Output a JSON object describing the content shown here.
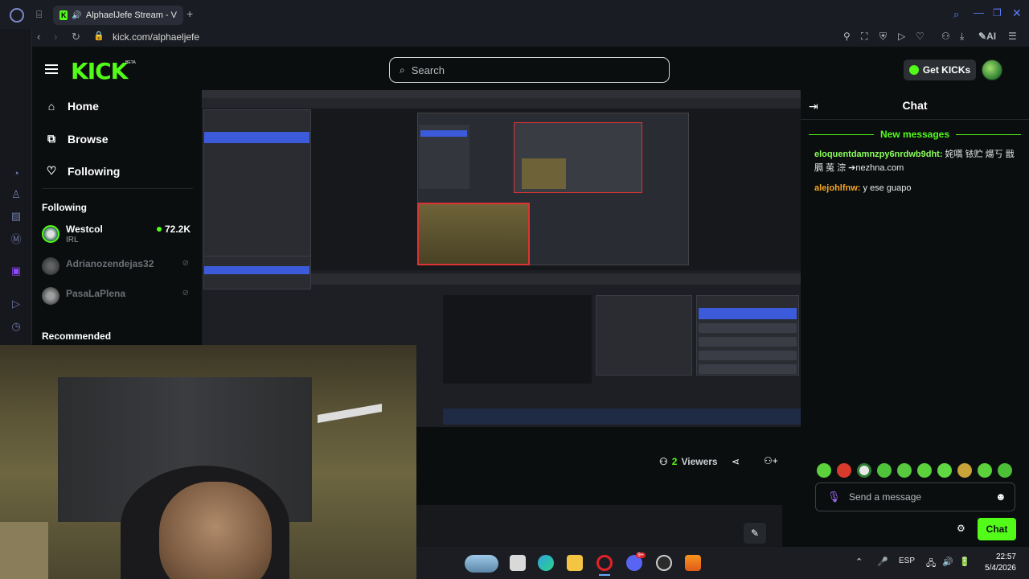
{
  "browser": {
    "tab_title": "AlphaelJefe Stream - V",
    "new_tab": "+",
    "url": "kick.com/alphaeljefe",
    "ai_label": "AI"
  },
  "header": {
    "logo": "KICK",
    "beta": "BETA",
    "search_placeholder": "Search",
    "get_kicks": "Get KICKs"
  },
  "nav": {
    "home": "Home",
    "browse": "Browse",
    "following": "Following"
  },
  "following_section": {
    "title": "Following",
    "channels": [
      {
        "name": "Westcol",
        "category": "IRL",
        "viewers": "72.2K",
        "live": true
      },
      {
        "name": "Adrianozendejas32",
        "live": false
      },
      {
        "name": "PasaLaPlena",
        "live": false
      }
    ]
  },
  "recommended_title": "Recommended",
  "stream": {
    "viewers_count": "2",
    "viewers_label": "Viewers"
  },
  "chat": {
    "title": "Chat",
    "new_messages": "New messages",
    "messages": [
      {
        "user": "eloquentdamnzpy6nrdwb9dht:",
        "text": " 姹嚆 铱贮 煬丂 戩膈 莵 淙 ➔nezhna.com"
      },
      {
        "user": "alejohlfnw:",
        "text": " y ese guapo"
      }
    ],
    "input_placeholder": "Send a message",
    "send_button": "Chat"
  },
  "taskbar": {
    "lang": "ESP",
    "time": "22:57",
    "date": "5/4/2026",
    "discord_badge": "9+"
  },
  "colors": {
    "accent": "#53fc18",
    "background": "#0b0e0f"
  }
}
